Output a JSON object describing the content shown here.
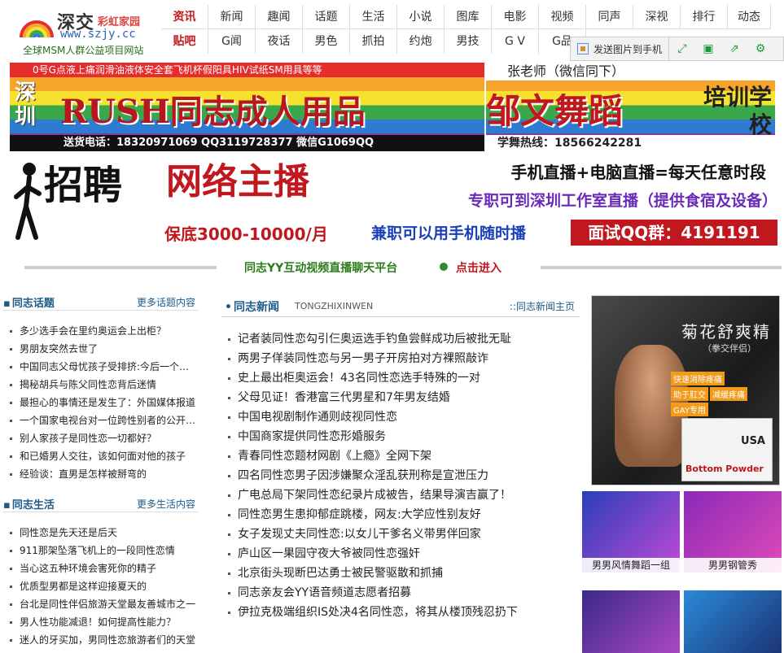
{
  "header": {
    "logo_name": "深交",
    "logo_sub": "彩虹家园",
    "logo_url": "www.szjy.cc",
    "logo_tagline": "全球MSM人群公益项目网站"
  },
  "nav": {
    "row1": [
      "资讯",
      "新闻",
      "趣闻",
      "话题",
      "生活",
      "小说",
      "图库",
      "电影",
      "视频",
      "同声",
      "深视",
      "排行",
      "动态"
    ],
    "row2": [
      "贴吧",
      "G闻",
      "夜话",
      "男色",
      "抓拍",
      "约炮",
      "男技",
      "G V",
      "G品"
    ]
  },
  "toolbar": {
    "send_label": "发送图片到手机"
  },
  "banner1": {
    "top": "0号G点液上痛润滑油液体安全套飞机杯假阳具HIV试纸SM用具等等",
    "city": "深圳",
    "main": "RUSH同志成人用品",
    "phone": "送货电话：18320971069 QQ3119728377 微信G1069QQ"
  },
  "banner2": {
    "top": "张老师（微信同下）",
    "main": "邹文舞蹈",
    "side": "培训学校",
    "phone": "学舞热线：18566242281"
  },
  "banner3": {
    "recruit": "招聘",
    "title": "网络主播",
    "right1": "手机直播+电脑直播=每天任意时段",
    "right2": "专职可到深圳工作室直播（提供食宿及设备）",
    "salary": "保底3000-10000/月",
    "part": "兼职可以用手机随时播",
    "qq": "面试QQ群：4191191"
  },
  "yy": {
    "text": "同志YY互动视频直播聊天平台",
    "enter": "点击进入"
  },
  "topics": {
    "title": "同志话题",
    "more": "更多话题内容",
    "items": [
      "多少选手会在里约奥运会上出柜？",
      "男朋友突然去世了",
      "中国同志父母忧孩子受排挤:今后一个人怎么办",
      "揭秘胡兵与陈父同性恋背后迷情",
      "最担心的事情还是发生了：外国媒体报道",
      "一个国家电视台对一位跨性别者的公开报道",
      "别人家孩子是同性恋一切都好？",
      "和已婚男人交往，该如何面对他的孩子",
      "经验谈：直男是怎样被掰弯的"
    ]
  },
  "life": {
    "title": "同志生活",
    "more": "更多生活内容",
    "items": [
      "同性恋是先天还是后天",
      "911那架坠落飞机上的一段同性恋情",
      "当心这五种环境会害死你的精子",
      "优质型男都是这样迎接夏天的",
      "台北是同性伴侣旅游天堂最友善城市之一",
      "男人性功能减退！如何提高性能力？",
      "迷人的牙买加，男同性恋旅游者们的天堂"
    ]
  },
  "news": {
    "title": "同志新闻",
    "pinyin": "TONGZHIXINWEN",
    "more": "::同志新闻主页",
    "items": [
      "记者装同性恋勾引仨奥运选手钓鱼尝鲜成功后被批无耻",
      "两男子佯装同性恋与另一男子开房拍对方裸照敲诈",
      "史上最出柜奥运会！43名同性恋选手特殊的一对",
      "父母见证！香港富三代男星和7年男友结婚",
      "中国电视剧制作通则歧视同性恋",
      "中国商家提供同性恋形婚服务",
      "青春同性恋题材网剧《上瘾》全网下架",
      "四名同性恋男子因涉嫌聚众淫乱获刑称是宣泄压力",
      "广电总局下架同性恋纪录片成被告，结果导演吉赢了！",
      "同性恋男生患抑郁症跳楼，网友:大学应性别友好",
      "女子发现丈夫同性恋:以女儿干爹名义带男伴回家",
      "庐山区一果园守夜大爷被同性恋强奸",
      "北京街头现断巴达勇士被民警驱散和抓捕",
      "同志亲友会YY语音频道志愿者招募",
      "伊拉克极端组织IS处决4名同性恋，将其从楼顶残忍扔下"
    ]
  },
  "ad_pill": {
    "name": "菊花舒爽精",
    "sub": "（拳交伴侣）",
    "tags": [
      "快速消除疼痛",
      "助于肛交",
      "减缓疼痛",
      "GAY专用"
    ],
    "box_label": "USA",
    "box_name": "Bottom Powder"
  },
  "thumbs": [
    {
      "caption": "男男风情舞蹈一组",
      "color1": "#2a3fb8",
      "color2": "#c04ad8"
    },
    {
      "caption": "男男钢管秀",
      "color1": "#8a2ab8",
      "color2": "#e04ab8"
    },
    {
      "caption": "",
      "color1": "#3a2a8a",
      "color2": "#b84ac8"
    },
    {
      "caption": "",
      "color1": "#2a8ad8",
      "color2": "#1a2a6a"
    }
  ]
}
